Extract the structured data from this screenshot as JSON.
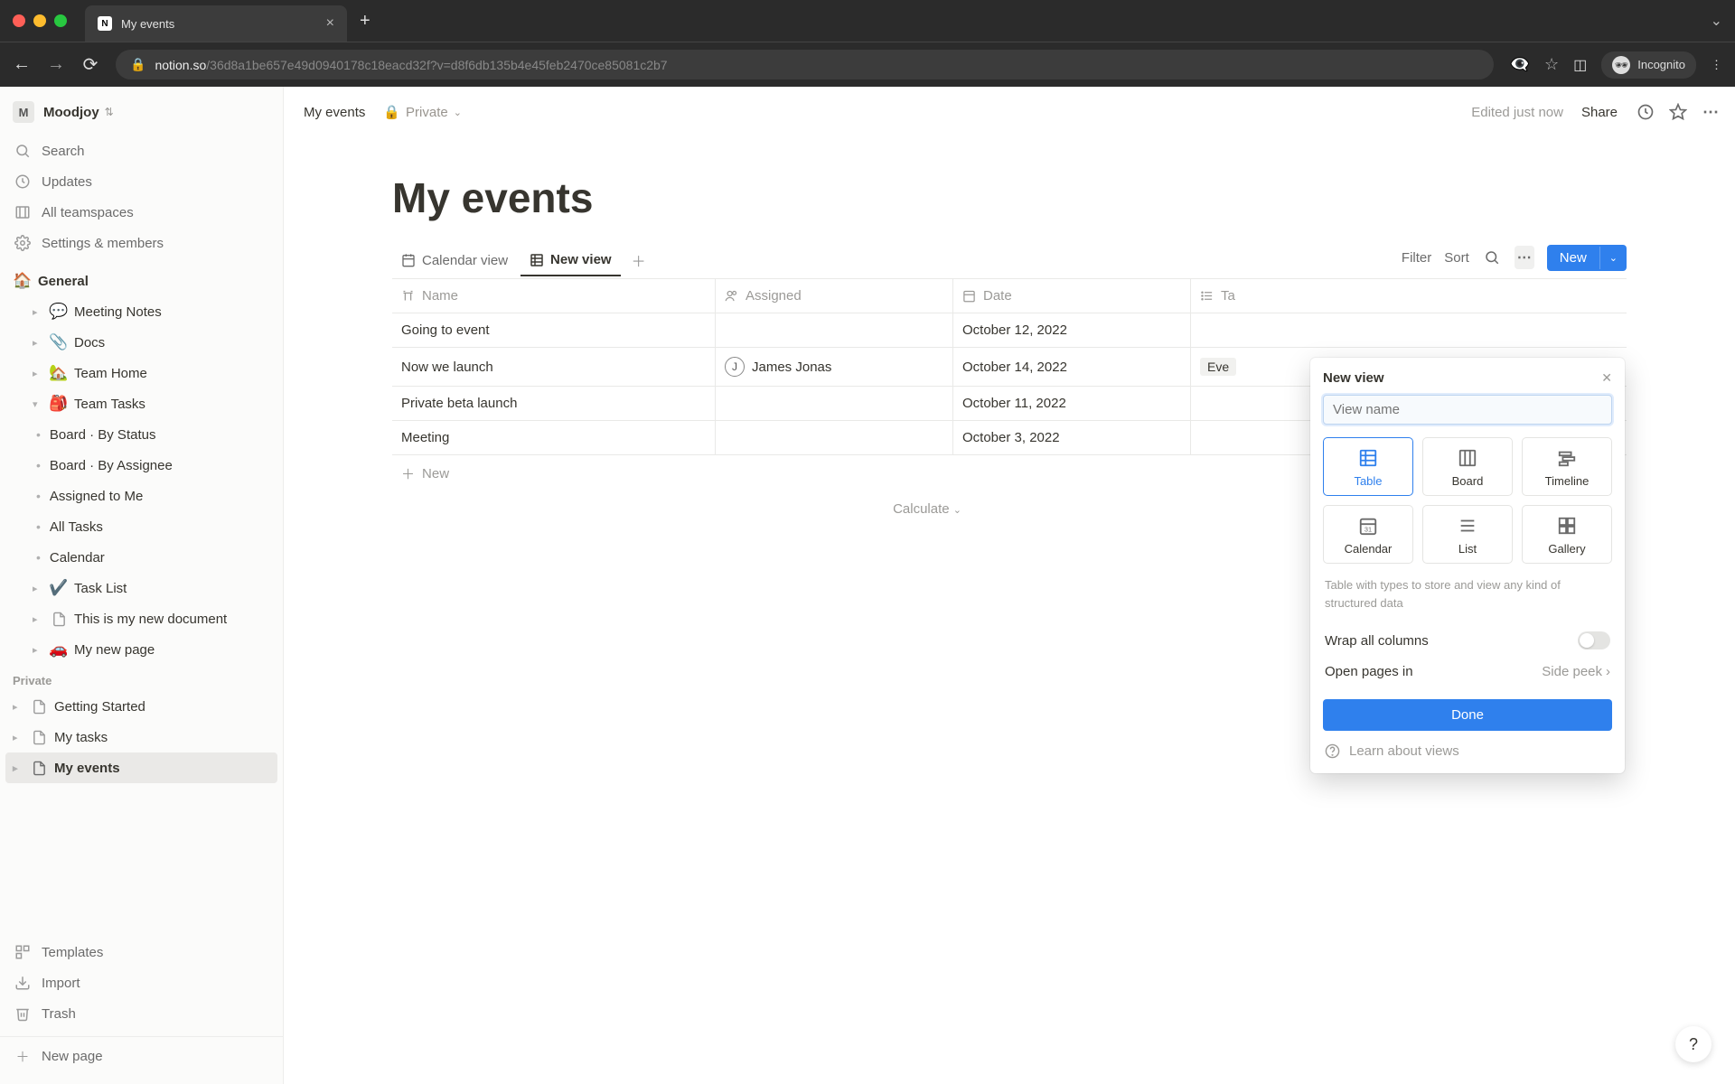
{
  "browser": {
    "tab_title": "My events",
    "url_domain": "notion.so",
    "url_path": "/36d8a1be657e49d0940178c18eacd32f?v=d8f6db135b4e45feb2470ce85081c2b7",
    "incognito_label": "Incognito"
  },
  "workspace": {
    "initial": "M",
    "name": "Moodjoy"
  },
  "sidebar": {
    "search": "Search",
    "updates": "Updates",
    "teamspaces": "All teamspaces",
    "settings": "Settings & members",
    "general": "General",
    "pages": {
      "meeting_notes": "Meeting Notes",
      "docs": "Docs",
      "team_home": "Team Home",
      "team_tasks": "Team Tasks",
      "board_status": "Board · By Status",
      "board_assignee": "Board · By Assignee",
      "assigned_me": "Assigned to Me",
      "all_tasks": "All Tasks",
      "calendar": "Calendar",
      "task_list": "Task List",
      "new_doc": "This is my new document",
      "new_page": "My new page"
    },
    "private_label": "Private",
    "private_pages": {
      "getting_started": "Getting Started",
      "my_tasks": "My tasks",
      "my_events": "My events"
    },
    "bottom": {
      "templates": "Templates",
      "import": "Import",
      "trash": "Trash",
      "new_page": "New page"
    }
  },
  "topbar": {
    "crumb1": "My events",
    "privacy": "Private",
    "edited": "Edited just now",
    "share": "Share"
  },
  "page": {
    "title": "My events"
  },
  "views": {
    "calendar": "Calendar view",
    "new_view": "New view",
    "filter": "Filter",
    "sort": "Sort",
    "new_btn": "New"
  },
  "table": {
    "cols": {
      "name": "Name",
      "assigned": "Assigned",
      "date": "Date",
      "tags": "Ta"
    },
    "rows": [
      {
        "name": "Going to event",
        "assigned": "",
        "date": "October 12, 2022",
        "tag": ""
      },
      {
        "name": "Now we launch",
        "assigned": "James Jonas",
        "assigned_initial": "J",
        "date": "October 14, 2022",
        "tag": "Eve"
      },
      {
        "name": "Private beta launch",
        "assigned": "",
        "date": "October 11, 2022",
        "tag": ""
      },
      {
        "name": "Meeting",
        "assigned": "",
        "date": "October 3, 2022",
        "tag": ""
      }
    ],
    "new_row": "New",
    "calculate": "Calculate"
  },
  "popover": {
    "title": "New view",
    "placeholder": "View name",
    "types": {
      "table": "Table",
      "board": "Board",
      "timeline": "Timeline",
      "calendar": "Calendar",
      "list": "List",
      "gallery": "Gallery"
    },
    "desc": "Table with types to store and view any kind of structured data",
    "wrap": "Wrap all columns",
    "open_in": "Open pages in",
    "open_in_val": "Side peek",
    "done": "Done",
    "learn": "Learn about views"
  },
  "help": "?"
}
